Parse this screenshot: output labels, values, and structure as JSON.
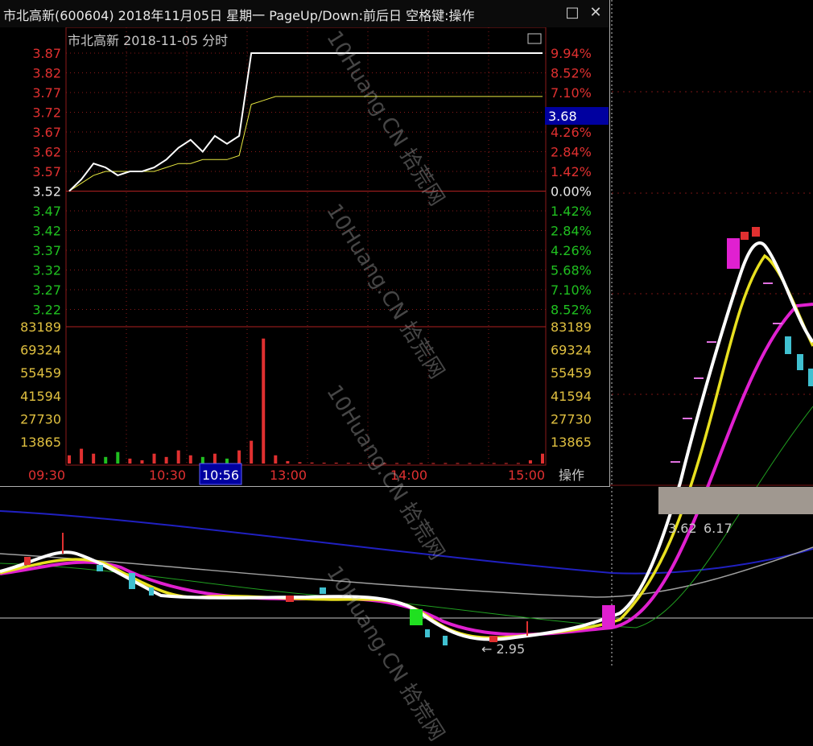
{
  "window": {
    "title": "市北高新(600604) 2018年11月05日 星期一 PageUp/Down:前后日 空格键:操作",
    "max_icon": "□",
    "close_icon": "✕"
  },
  "intraday": {
    "header": "市北高新  2018-11-05 分时",
    "prev_close": 3.52,
    "price_ticks": [
      "3.87",
      "3.82",
      "3.77",
      "3.72",
      "3.67",
      "3.62",
      "3.57",
      "3.52",
      "3.47",
      "3.42",
      "3.37",
      "3.32",
      "3.27",
      "3.22"
    ],
    "pct_ticks": [
      "9.94%",
      "8.52%",
      "7.10%",
      "5.68%",
      "4.26%",
      "2.84%",
      "1.42%",
      "0.00%",
      "1.42%",
      "2.84%",
      "4.26%",
      "5.68%",
      "7.10%",
      "8.52%"
    ],
    "price_range": [
      3.22,
      3.87
    ],
    "current_value": "3.68",
    "volume_ticks": [
      "83189",
      "69324",
      "55459",
      "41594",
      "27730",
      "13865"
    ],
    "volume_max": 83189,
    "time_labels": [
      "09:30",
      "10:30",
      "10:56",
      "13:00",
      "14:00",
      "15:00"
    ],
    "selected_time": "10:56",
    "action_label": "操作",
    "colors": {
      "up": "#e03030",
      "down": "#20c020",
      "price_line": "#ffffff",
      "avg_line": "#e8e840",
      "grid": "#8b1a1a",
      "highlight": "#0000a0"
    }
  },
  "chart_data": {
    "type": "line",
    "title": "市北高新  2018-11-05 分时",
    "x_labels": [
      "09:30",
      "10:30",
      "10:56",
      "13:00",
      "14:00",
      "15:00"
    ],
    "series": [
      {
        "values": [
          3.52,
          3.55,
          3.59,
          3.58,
          3.56,
          3.57,
          3.57,
          3.58,
          3.6,
          3.63,
          3.65,
          3.62,
          3.66,
          3.64,
          3.66,
          3.87,
          3.87,
          3.87,
          3.87,
          3.87,
          3.87,
          3.87,
          3.87,
          3.87,
          3.87,
          3.87,
          3.87,
          3.87,
          3.87,
          3.87,
          3.87,
          3.87,
          3.87,
          3.87,
          3.87,
          3.87,
          3.87,
          3.87,
          3.87,
          3.87
        ]
      },
      {
        "values": [
          3.52,
          3.54,
          3.56,
          3.57,
          3.57,
          3.57,
          3.57,
          3.57,
          3.58,
          3.59,
          3.59,
          3.6,
          3.6,
          3.6,
          3.61,
          3.74,
          3.75,
          3.76,
          3.76,
          3.76,
          3.76,
          3.76,
          3.76,
          3.76,
          3.76,
          3.76,
          3.76,
          3.76,
          3.76,
          3.76,
          3.76,
          3.76,
          3.76,
          3.76,
          3.76,
          3.76,
          3.76,
          3.76,
          3.76,
          3.76
        ]
      }
    ],
    "volume": [
      5000,
      9000,
      6000,
      4000,
      7000,
      3000,
      2000,
      6000,
      4000,
      8000,
      5000,
      4000,
      6000,
      3000,
      8000,
      13865,
      76000,
      5000,
      1500,
      800,
      600,
      500,
      500,
      400,
      400,
      300,
      300,
      300,
      300,
      300,
      300,
      300,
      300,
      300,
      300,
      300,
      300,
      300,
      2000,
      6000
    ],
    "ylim": [
      3.22,
      3.87
    ],
    "grid": true
  },
  "background_chart": {
    "labels": {
      "low": "← 2.95",
      "a": "3.62",
      "b": "6.17"
    }
  }
}
